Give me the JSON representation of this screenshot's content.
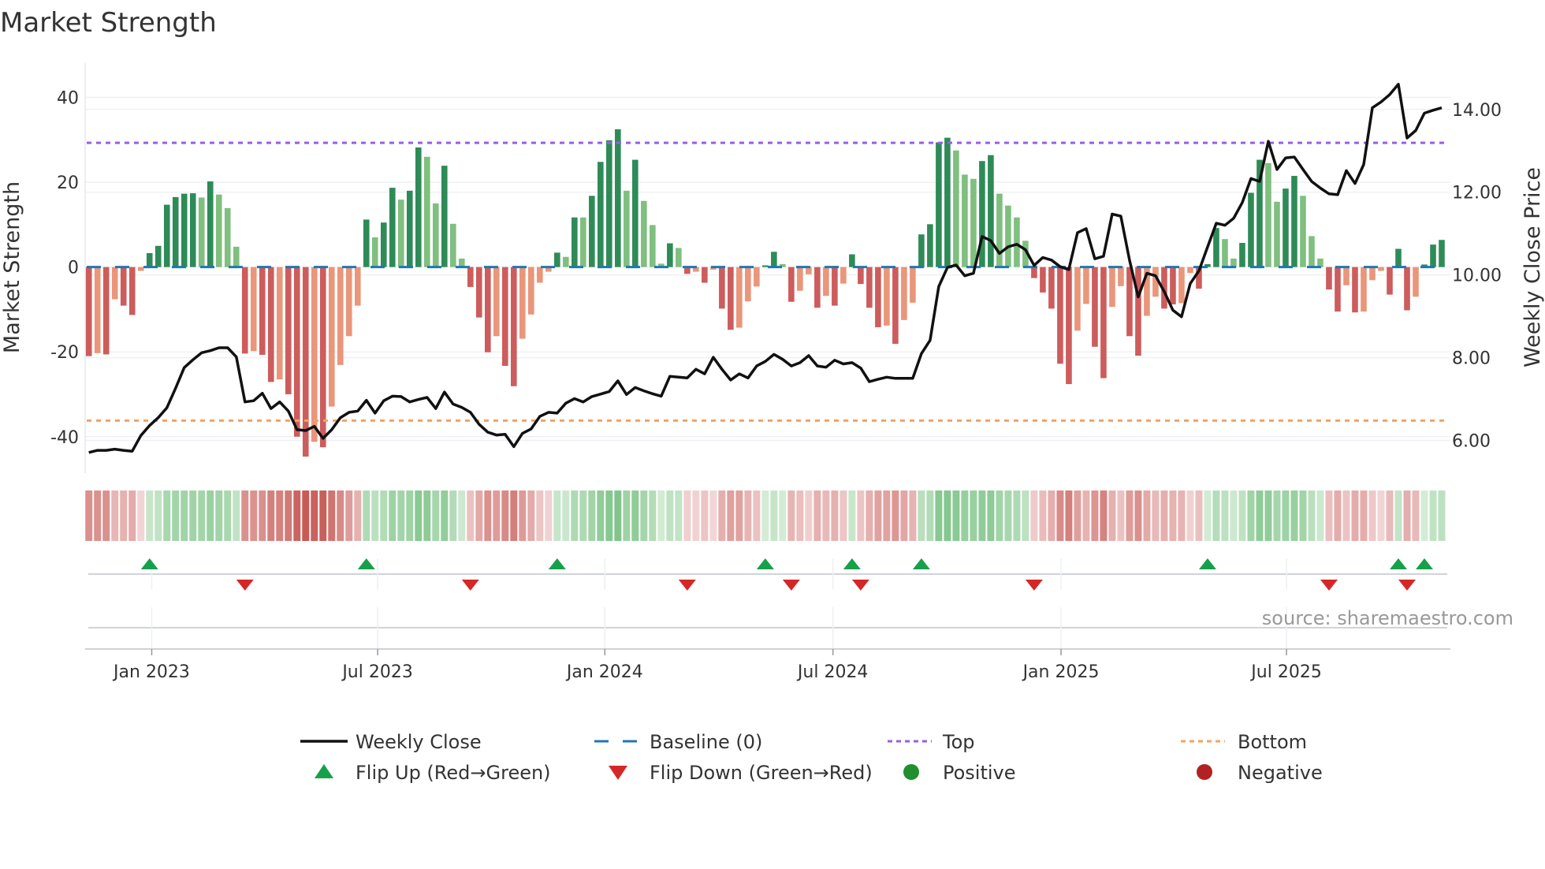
{
  "chart_data": {
    "type": "bar",
    "title": "Market Strength",
    "ylabel": "Market Strength",
    "y2label": "Weekly Close Price",
    "ylim": [
      -48.6,
      48.1
    ],
    "y2lim": [
      5.21,
      15.12
    ],
    "xlim_week": [
      0.57,
      158.0
    ],
    "yticks": [
      40,
      20,
      0,
      -20,
      -40
    ],
    "y2ticks": [
      14,
      12,
      10,
      8,
      6
    ],
    "y2tick_labels": [
      "14.00",
      "12.00",
      "10.00",
      "8.00",
      "6.00"
    ],
    "xticks": [
      {
        "label": "Jan 2023",
        "week": 8.25
      },
      {
        "label": "Jul 2023",
        "week": 34.3
      },
      {
        "label": "Jan 2024",
        "week": 60.5
      },
      {
        "label": "Jul 2024",
        "week": 86.8
      },
      {
        "label": "Jan 2025",
        "week": 113.1
      },
      {
        "label": "Jul 2025",
        "week": 139.1
      }
    ],
    "top_level": 29.3,
    "bottom_level": -36.2,
    "baseline": 0,
    "strength": [
      -21,
      -20.3,
      -20.6,
      -7.6,
      -9.1,
      -11.3,
      -0.9,
      3.3,
      5,
      14.7,
      16.5,
      17.3,
      17.4,
      16.4,
      20.2,
      17.1,
      13.9,
      4.8,
      -20.4,
      -19.8,
      -20.7,
      -27.1,
      -26.5,
      -30,
      -40,
      -44.7,
      -41.2,
      -42.5,
      -32.9,
      -23.1,
      -16.3,
      -9.1,
      11.2,
      7,
      10.5,
      18.7,
      15.9,
      18,
      28.2,
      26,
      15,
      23.9,
      10.2,
      2,
      -4.7,
      -11.9,
      -20.1,
      -16.3,
      -23.3,
      -28.1,
      -16.9,
      -11.2,
      -3.7,
      -1.1,
      3.4,
      2.4,
      11.7,
      11.7,
      16.8,
      24.8,
      29.9,
      32.5,
      18,
      25.3,
      15.6,
      9.9,
      0.8,
      5.6,
      4.5,
      -1.6,
      -1.1,
      -3.7,
      -0.6,
      -9.8,
      -14.8,
      -14.3,
      -8.1,
      -4.6,
      0.4,
      3.6,
      0.7,
      -8.2,
      -5.6,
      -1.7,
      -9.6,
      -6.8,
      -9.1,
      -3.9,
      3,
      -4,
      -9.6,
      -14.2,
      -13.8,
      -18.1,
      -12.5,
      -8.4,
      7.7,
      10.1,
      29.4,
      30.5,
      27.5,
      21.8,
      20.8,
      25,
      26.4,
      17.3,
      14.5,
      11.7,
      6.2,
      -2.6,
      -6,
      -9.8,
      -22.8,
      -27.6,
      -15,
      -8.7,
      -18.8,
      -26.2,
      -9.4,
      -4.5,
      -16.3,
      -20.9,
      -11.5,
      -7,
      -9.8,
      -8.8,
      -8.5,
      -1.4,
      -5.1,
      0.7,
      9.2,
      6.6,
      2,
      5.7,
      17.5,
      25.3,
      24.5,
      15.4,
      18.5,
      21.5,
      16.8,
      7.3,
      2,
      -5.3,
      -10.5,
      -4.3,
      -10.7,
      -10.5,
      -3.1,
      -0.9,
      -6.5,
      4.3,
      -10.2,
      -7,
      0.6,
      5.3,
      6.4
    ],
    "strength_shade": [
      "d",
      "l",
      "d",
      "l",
      "d",
      "d",
      "l",
      "d",
      "d",
      "d",
      "d",
      "d",
      "d",
      "l",
      "d",
      "l",
      "l",
      "l",
      "d",
      "l",
      "d",
      "d",
      "l",
      "d",
      "d",
      "d",
      "l",
      "d",
      "l",
      "l",
      "l",
      "l",
      "d",
      "l",
      "d",
      "d",
      "l",
      "d",
      "d",
      "l",
      "l",
      "d",
      "l",
      "l",
      "d",
      "d",
      "d",
      "l",
      "d",
      "d",
      "l",
      "l",
      "l",
      "l",
      "d",
      "l",
      "d",
      "l",
      "d",
      "d",
      "d",
      "d",
      "l",
      "d",
      "l",
      "l",
      "l",
      "d",
      "l",
      "d",
      "l",
      "d",
      "l",
      "d",
      "d",
      "l",
      "l",
      "l",
      "d",
      "d",
      "l",
      "d",
      "l",
      "l",
      "d",
      "l",
      "d",
      "l",
      "d",
      "d",
      "d",
      "d",
      "l",
      "d",
      "l",
      "l",
      "d",
      "d",
      "d",
      "d",
      "l",
      "l",
      "l",
      "d",
      "d",
      "l",
      "l",
      "l",
      "l",
      "d",
      "d",
      "d",
      "d",
      "d",
      "l",
      "l",
      "d",
      "d",
      "l",
      "l",
      "d",
      "d",
      "l",
      "l",
      "d",
      "d",
      "l",
      "l",
      "d",
      "d",
      "d",
      "l",
      "l",
      "d",
      "d",
      "d",
      "l",
      "l",
      "d",
      "d",
      "l",
      "l",
      "l",
      "d",
      "d",
      "l",
      "d",
      "l",
      "l",
      "l",
      "d",
      "d",
      "d",
      "l",
      "d",
      "d",
      "d"
    ],
    "weekly_close": [
      5.71,
      5.76,
      5.76,
      5.79,
      5.76,
      5.74,
      6.12,
      6.36,
      6.55,
      6.79,
      7.26,
      7.76,
      7.95,
      8.12,
      8.17,
      8.24,
      8.24,
      8.02,
      6.93,
      6.96,
      7.14,
      6.77,
      6.93,
      6.71,
      6.26,
      6.24,
      6.34,
      6.05,
      6.26,
      6.55,
      6.68,
      6.71,
      6.97,
      6.66,
      6.96,
      7.07,
      7.06,
      6.93,
      6.99,
      7.04,
      6.77,
      7.17,
      6.88,
      6.8,
      6.68,
      6.39,
      6.2,
      6.13,
      6.15,
      5.85,
      6.17,
      6.28,
      6.58,
      6.68,
      6.66,
      6.9,
      7.01,
      6.93,
      7.06,
      7.12,
      7.18,
      7.44,
      7.11,
      7.28,
      7.2,
      7.13,
      7.07,
      7.55,
      7.53,
      7.51,
      7.72,
      7.61,
      8.01,
      7.72,
      7.46,
      7.61,
      7.51,
      7.8,
      7.91,
      8.08,
      7.96,
      7.8,
      7.88,
      8.05,
      7.8,
      7.77,
      7.94,
      7.85,
      7.88,
      7.75,
      7.42,
      7.48,
      7.53,
      7.5,
      7.5,
      7.5,
      8.1,
      8.42,
      9.72,
      10.18,
      10.24,
      9.98,
      10.04,
      10.93,
      10.83,
      10.52,
      10.68,
      10.74,
      10.61,
      10.23,
      10.42,
      10.36,
      10.2,
      10.13,
      11.02,
      11.12,
      10.39,
      10.45,
      11.47,
      11.42,
      10.36,
      9.47,
      10.04,
      9.98,
      9.6,
      9.15,
      8.99,
      9.79,
      10.1,
      10.68,
      11.25,
      11.2,
      11.37,
      11.75,
      12.33,
      12.26,
      13.23,
      12.55,
      12.83,
      12.85,
      12.55,
      12.26,
      12.1,
      11.96,
      11.94,
      12.52,
      12.21,
      12.67,
      14.04,
      14.18,
      14.36,
      14.61,
      13.31,
      13.49,
      13.91,
      13.98,
      14.04
    ],
    "flip_up_weeks": [
      8,
      33,
      55,
      79,
      89,
      97,
      130,
      152,
      155
    ],
    "flip_down_weeks": [
      19,
      45,
      70,
      82,
      90,
      110,
      144,
      153
    ],
    "legend": [
      {
        "label": "Weekly Close",
        "kind": "line"
      },
      {
        "label": "Baseline (0)",
        "kind": "dash"
      },
      {
        "label": "Top",
        "kind": "dot-purple"
      },
      {
        "label": "Bottom",
        "kind": "dot-orange"
      },
      {
        "label": "Flip Up (Red→Green)",
        "kind": "tri-up"
      },
      {
        "label": "Flip Down (Green→Red)",
        "kind": "tri-down"
      },
      {
        "label": "Positive",
        "kind": "circle-green"
      },
      {
        "label": "Negative",
        "kind": "circle-red"
      }
    ],
    "legend_placement": "bottom",
    "grid": true,
    "source": "source: sharemaestro.com"
  },
  "colors": {
    "pos_dark": "#2e8b57",
    "pos_light": "#7fbf7f",
    "neg_dark": "#cd5c5c",
    "neg_light": "#e9967a",
    "price": "#111111",
    "baseline": "#1f77b4",
    "top": "#9b5de5",
    "bottom": "#f4a261",
    "flip_up": "#17a04a",
    "flip_down": "#d62728",
    "positive": "#1f8f2f",
    "negative": "#b22222"
  }
}
